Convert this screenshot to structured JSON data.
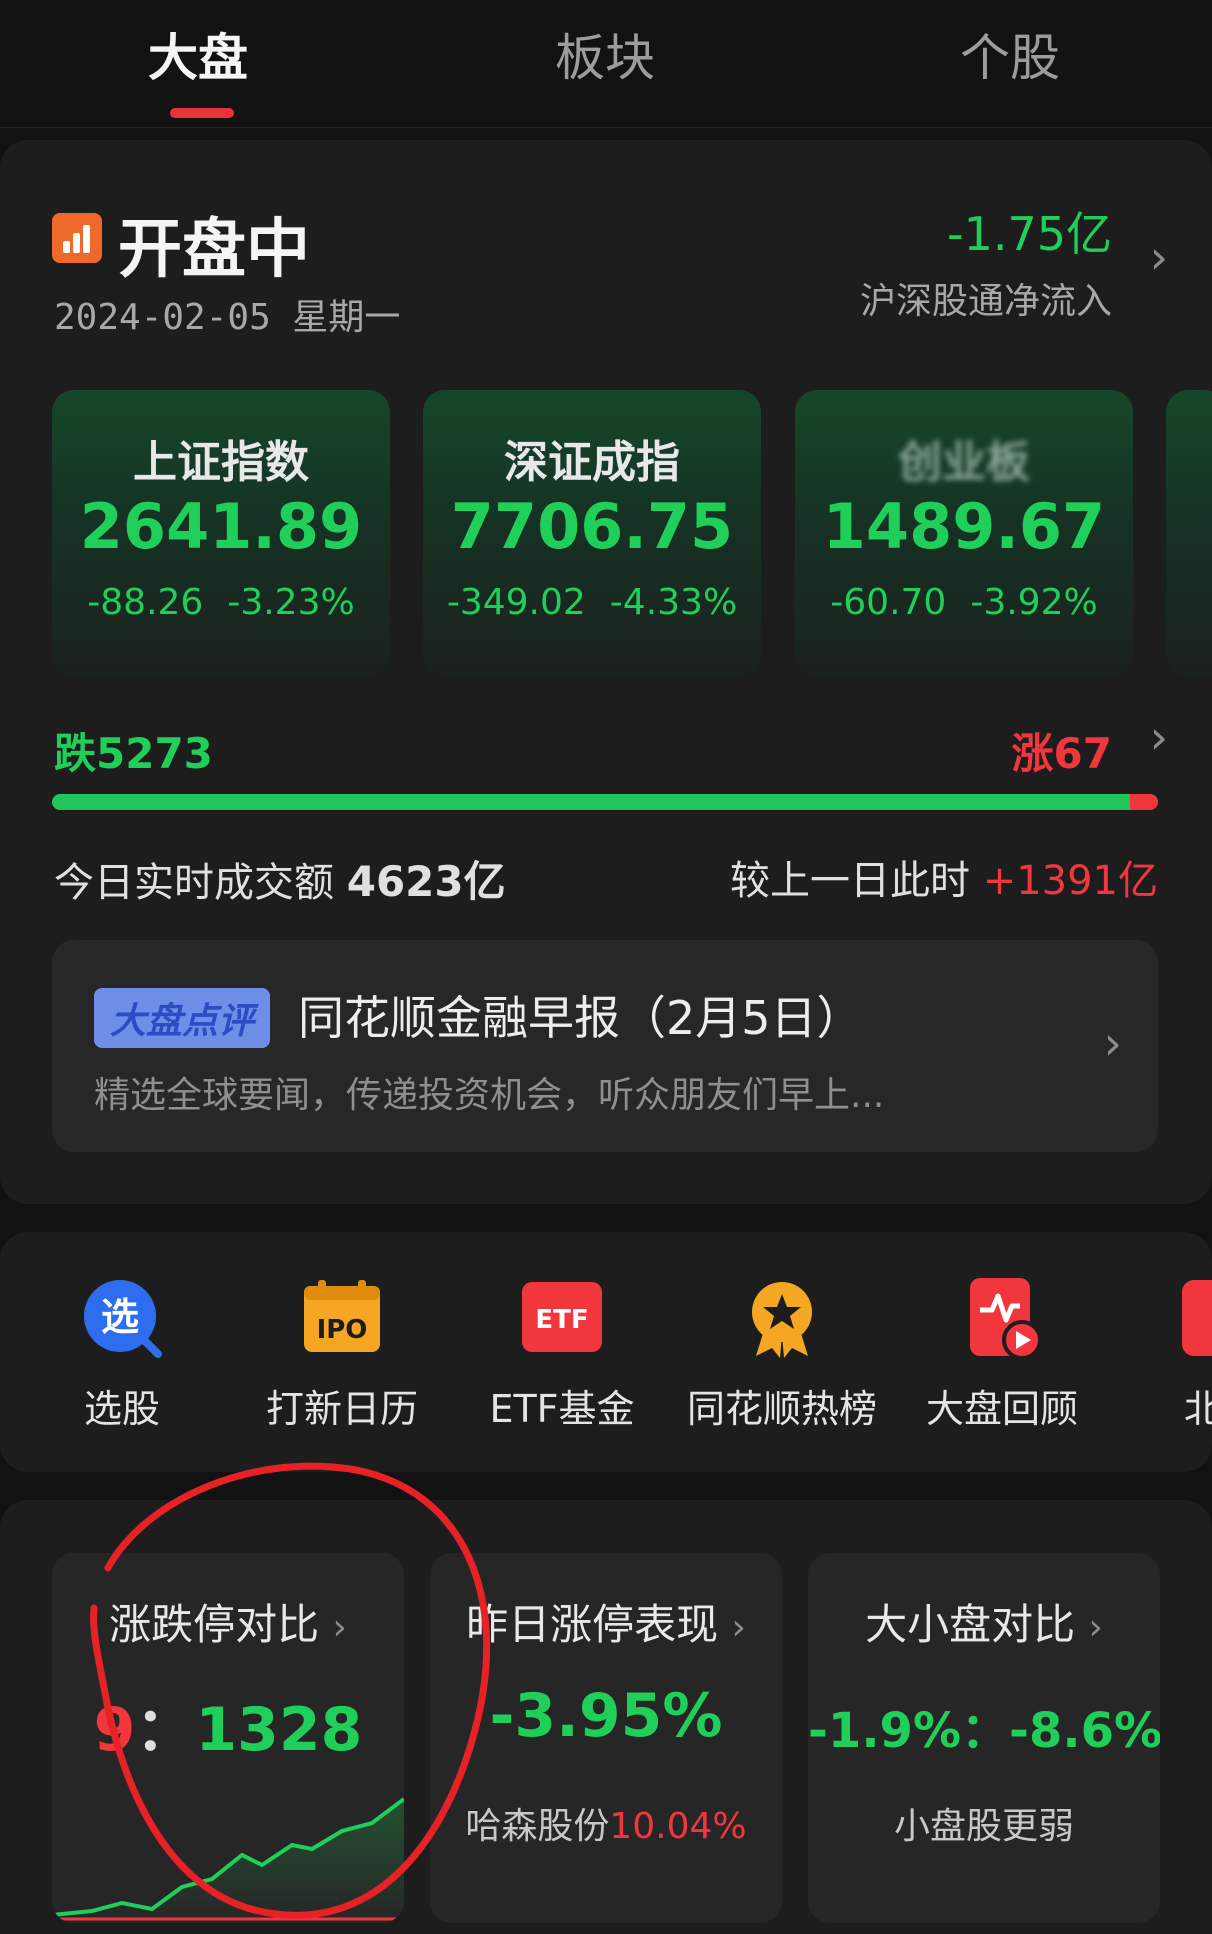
{
  "tabs": [
    {
      "label": "大盘",
      "active": true
    },
    {
      "label": "板块",
      "active": false
    },
    {
      "label": "个股",
      "active": false
    }
  ],
  "market": {
    "status": "开盘中",
    "date": "2024-02-05 星期一",
    "net_flow_value": "-1.75亿",
    "net_flow_label": "沪深股通净流入",
    "indices": [
      {
        "name": "上证指数",
        "value": "2641.89",
        "change": "-88.26",
        "change_pct": "-3.23%"
      },
      {
        "name": "深证成指",
        "value": "7706.75",
        "change": "-349.02",
        "change_pct": "-4.33%"
      },
      {
        "name": "创业板",
        "value": "1489.67",
        "change": "-60.70",
        "change_pct": "-3.92%"
      }
    ],
    "fall_count": "跌5273",
    "rise_count": "涨67",
    "rise_share": 0.0125,
    "turnover_prefix": "今日实时成交额",
    "turnover_value": "4623亿",
    "compare_prefix": "较上一日此时",
    "compare_value": "+1391亿"
  },
  "news": {
    "tag": "大盘点评",
    "title": "同花顺金融早报（2月5日）",
    "subtitle": "精选全球要闻，传递投资机会，听众朋友们早上..."
  },
  "tools": [
    {
      "label": "选股",
      "icon": "stock-picker-icon"
    },
    {
      "label": "打新日历",
      "icon": "ipo-calendar-icon"
    },
    {
      "label": "ETF基金",
      "icon": "etf-icon"
    },
    {
      "label": "同花顺热榜",
      "icon": "hot-list-badge-icon"
    },
    {
      "label": "大盘回顾",
      "icon": "market-replay-icon"
    },
    {
      "label": "北交",
      "icon": "beijiao-icon"
    }
  ],
  "stats": {
    "limit_compare": {
      "title": "涨跌停对比",
      "up": "9",
      "sep": "：",
      "down": "1328"
    },
    "yesterday_limit": {
      "title": "昨日涨停表现",
      "value": "-3.95%",
      "sub_name": "哈森股份",
      "sub_value": "10.04%"
    },
    "size_compare": {
      "title": "大小盘对比",
      "value": "-1.9%：-8.6%",
      "sub": "小盘股更弱"
    }
  },
  "colors": {
    "up": "#f2363d",
    "down": "#1fcf5a",
    "background": "#121212",
    "card": "#1d1d1d",
    "accent": "#e8323c"
  }
}
